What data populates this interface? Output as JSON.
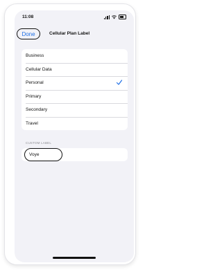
{
  "status_bar": {
    "time": "11:08"
  },
  "nav": {
    "done_label": "Done",
    "title": "Cellular Plan Label"
  },
  "label_options": [
    {
      "label": "Business",
      "selected": false
    },
    {
      "label": "Cellular Data",
      "selected": false
    },
    {
      "label": "Personal",
      "selected": true
    },
    {
      "label": "Primary",
      "selected": false
    },
    {
      "label": "Secondary",
      "selected": false
    },
    {
      "label": "Travel",
      "selected": false
    }
  ],
  "custom_label": {
    "header": "CUSTOM LABEL",
    "value": "Voye"
  },
  "colors": {
    "accent": "#1e6fe6",
    "background": "#f2f2f7"
  },
  "icons": [
    "signal-icon",
    "wifi-icon",
    "battery-icon",
    "checkmark-icon"
  ]
}
